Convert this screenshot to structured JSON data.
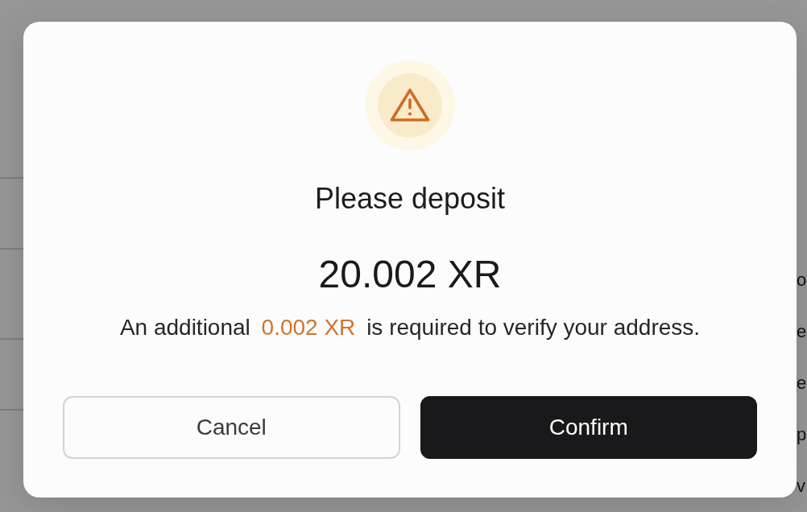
{
  "background": {
    "side_texts": [
      "o",
      "e",
      "e",
      "p",
      "v"
    ]
  },
  "dialog": {
    "title": "Please deposit",
    "amount": "20.002 XR",
    "message": {
      "before": "An additional",
      "highlight": "0.002 XR",
      "after": "is required to verify your address."
    },
    "buttons": [
      {
        "label": "Cancel",
        "kind": "secondary"
      },
      {
        "label": "Confirm",
        "kind": "primary"
      }
    ]
  }
}
